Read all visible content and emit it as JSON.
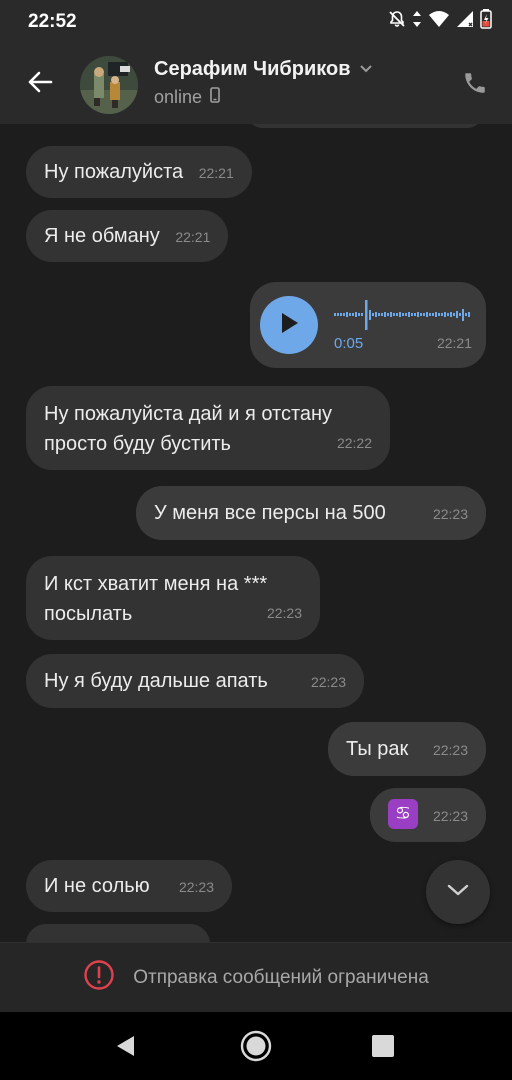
{
  "status_bar": {
    "time": "22:52",
    "icons": [
      "bell-off-icon",
      "data-arrows-icon",
      "wifi-icon",
      "signal-icon",
      "battery-charging-icon"
    ]
  },
  "header": {
    "contact_name": "Серафим Чибриков",
    "contact_status": "online",
    "icons": [
      "back-arrow-icon",
      "avatar",
      "chevron-down-icon",
      "mobile-device-icon",
      "phone-icon"
    ]
  },
  "messages": [
    {
      "direction": "in",
      "text": "Ну пожалуйста",
      "time": "22:21"
    },
    {
      "direction": "in",
      "text": "Я не обману",
      "time": "22:21"
    },
    {
      "direction": "out",
      "type": "voice",
      "duration": "0:05",
      "time": "22:21"
    },
    {
      "direction": "in",
      "text_line1": "Ну пожалуйста дай и я отстану",
      "text_line2": "просто буду бустить",
      "time": "22:22"
    },
    {
      "direction": "out",
      "text": "У меня все персы на 500",
      "time": "22:23"
    },
    {
      "direction": "in",
      "text_line1": "И кст хватит меня на ***",
      "text_line2": "посылать",
      "time": "22:23"
    },
    {
      "direction": "in",
      "text": "Ну я буду дальше апать",
      "time": "22:23"
    },
    {
      "direction": "out",
      "text": "Ты рак",
      "time": "22:23"
    },
    {
      "direction": "out",
      "emoji": "♋",
      "time": "22:23"
    },
    {
      "direction": "in",
      "text": "И не солью",
      "time": "22:23"
    }
  ],
  "restriction": {
    "text": "Отправка сообщений ограничена",
    "icon": "alert-circle-icon",
    "color": "#e0414e"
  },
  "colors": {
    "accent": "#6ea8e9",
    "background": "#1d1d1d",
    "bubble_in": "#333333",
    "bubble_out": "#3b3b3b"
  }
}
